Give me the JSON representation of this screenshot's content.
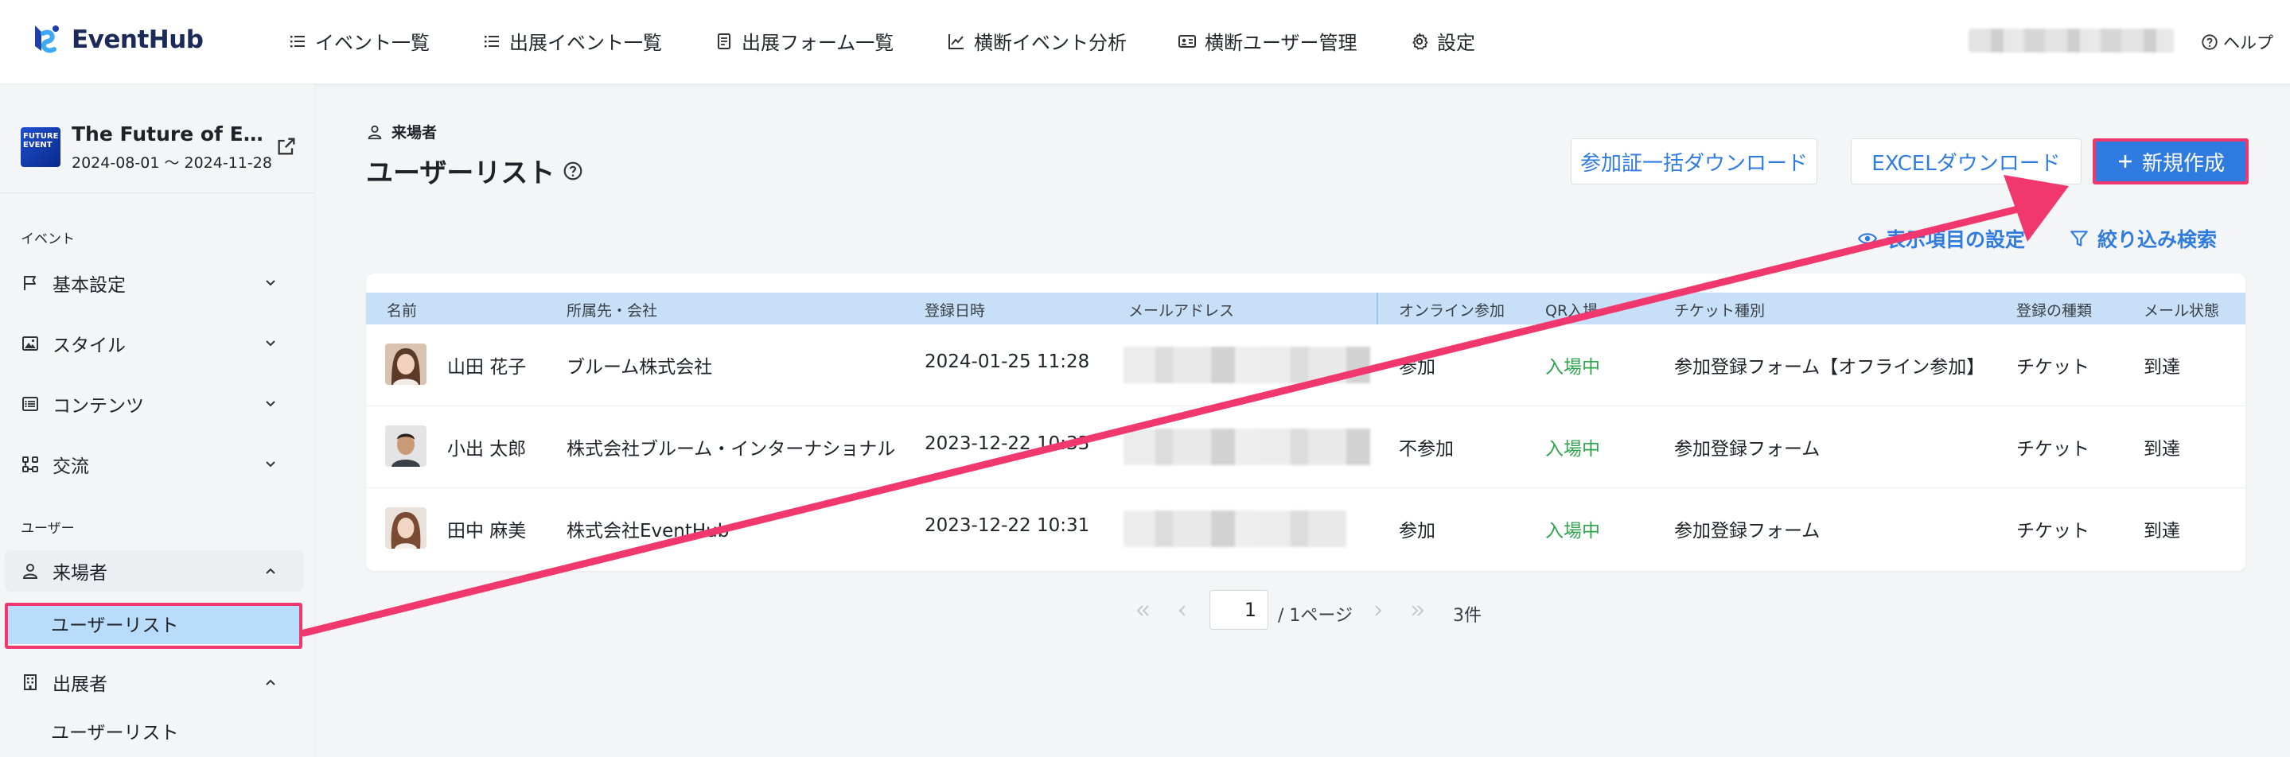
{
  "brand": {
    "name": "EventHub"
  },
  "topnav": {
    "items": [
      {
        "label": "イベント一覧",
        "icon": "list-icon"
      },
      {
        "label": "出展イベント一覧",
        "icon": "list-icon"
      },
      {
        "label": "出展フォーム一覧",
        "icon": "form-icon"
      },
      {
        "label": "横断イベント分析",
        "icon": "chart-icon"
      },
      {
        "label": "横断ユーザー管理",
        "icon": "id-card-icon"
      },
      {
        "label": "設定",
        "icon": "gear-icon"
      }
    ],
    "help": "ヘルプ"
  },
  "event": {
    "title": "The Future of Eve…",
    "dates": "2024-08-01 〜 2024-11-28",
    "thumb_text": "FUTURE EVENT"
  },
  "sidebar": {
    "section_event": "イベント",
    "event_items": [
      {
        "label": "基本設定",
        "icon": "flag-icon"
      },
      {
        "label": "スタイル",
        "icon": "image-icon"
      },
      {
        "label": "コンテンツ",
        "icon": "list-icon"
      },
      {
        "label": "交流",
        "icon": "network-icon"
      }
    ],
    "section_user": "ユーザー",
    "visitor": {
      "label": "来場者",
      "sub": "ユーザーリスト"
    },
    "exhibitor": {
      "label": "出展者",
      "sub": "ユーザーリスト"
    }
  },
  "main": {
    "breadcrumb": "来場者",
    "title": "ユーザーリスト",
    "buttons": {
      "bulk_download": "参加証一括ダウンロード",
      "excel_download": "EXCELダウンロード",
      "new": "新規作成"
    },
    "links": {
      "display_settings": "表示項目の設定",
      "filter": "絞り込み検索"
    }
  },
  "table": {
    "headers": [
      "名前",
      "所属先・会社",
      "登録日時",
      "メールアドレス",
      "オンライン参加",
      "QR入場",
      "チケット種別",
      "登録の種類",
      "メール状態"
    ],
    "rows": [
      {
        "name": "山田 花子",
        "company": "ブルーム株式会社",
        "date": "2024-01-25 11:28",
        "online": "参加",
        "status": "入場中",
        "ticket": "参加登録フォーム【オフライン参加】",
        "reg_type": "チケット",
        "mail": "到達"
      },
      {
        "name": "小出 太郎",
        "company": "株式会社ブルーム・インターナショナル",
        "date": "2023-12-22 10:33",
        "online": "不参加",
        "status": "入場中",
        "ticket": "参加登録フォーム",
        "reg_type": "チケット",
        "mail": "到達"
      },
      {
        "name": "田中 麻美",
        "company": "株式会社EventHub",
        "date": "2023-12-22 10:31",
        "online": "参加",
        "status": "入場中",
        "ticket": "参加登録フォーム",
        "reg_type": "チケット",
        "mail": "到達"
      }
    ]
  },
  "pager": {
    "page": "1",
    "total_pages": "/ 1ページ",
    "count": "3件"
  },
  "colors": {
    "accent": "#2f7be0",
    "annotation": "#f0386f",
    "header_bg": "#c7e0f7",
    "status_green": "#2ea44f"
  }
}
